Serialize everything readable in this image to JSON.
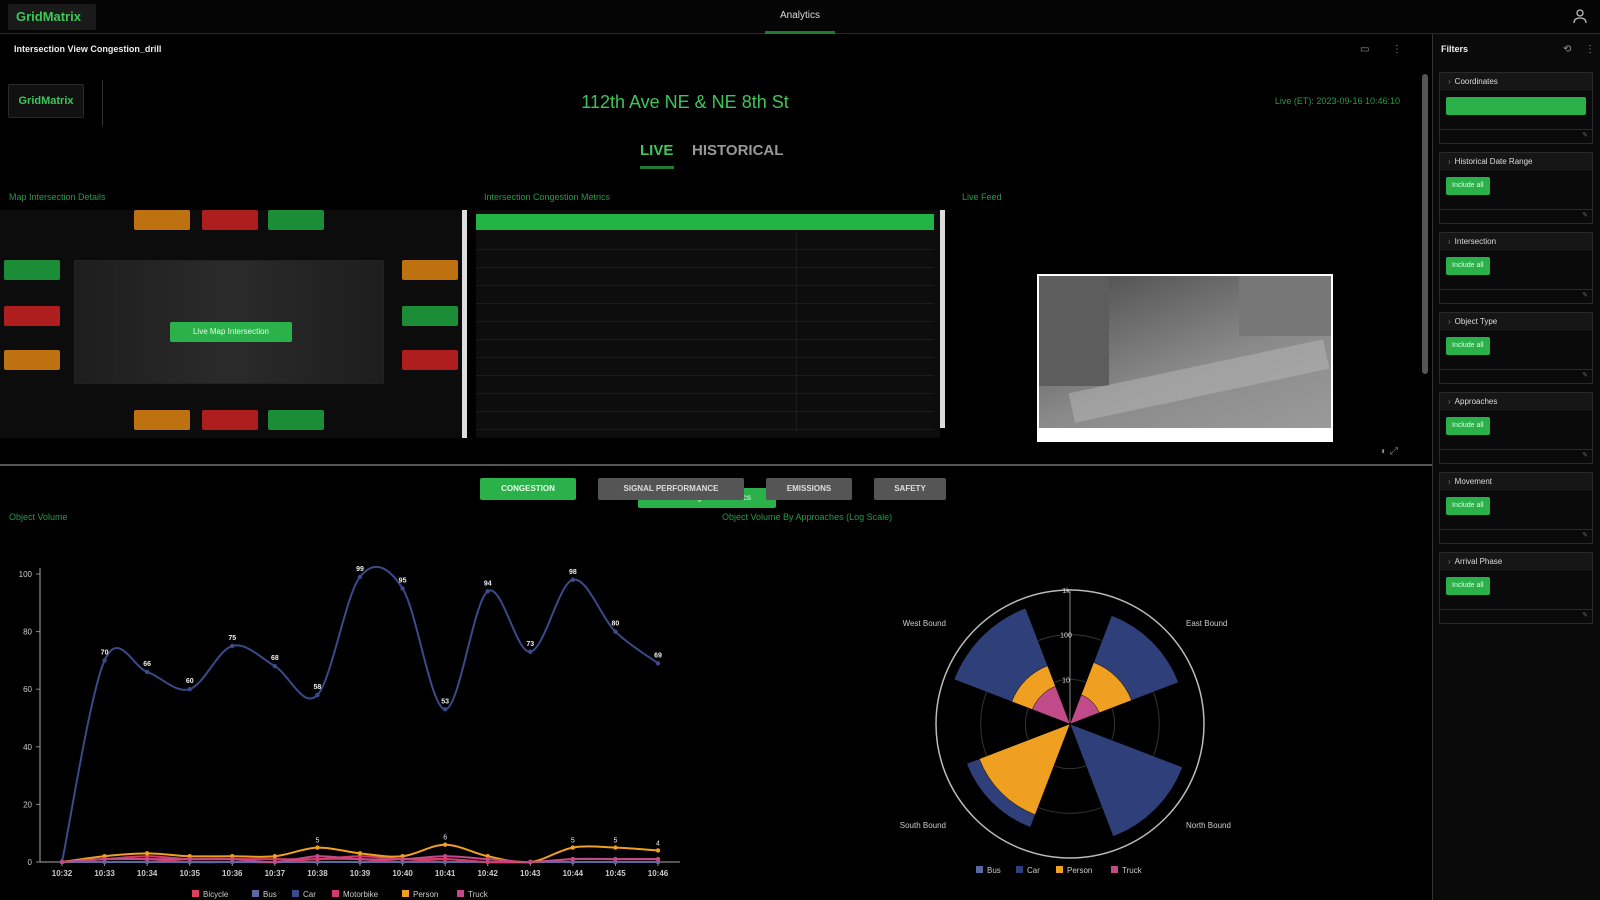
{
  "topbar": {
    "logo": "GridMatrix",
    "tab": "Analytics"
  },
  "panel": {
    "title": "Intersection View Congestion_drill",
    "brand": "GridMatrix",
    "location": "112th Ave NE & NE 8th St",
    "live_timestamp": "Live (ET): 2023-09-16 10:46:10",
    "tabs": {
      "live": "LIVE",
      "historical": "HISTORICAL"
    }
  },
  "map": {
    "label": "Map Intersection Details",
    "button": "Live Map Intersection",
    "signal_colors": {
      "orange": "#d07c10",
      "red": "#c02020",
      "green": "#1e9b3c"
    }
  },
  "congestion": {
    "label": "Intersection Congestion Metrics",
    "button": "View Congestion Metrics"
  },
  "feed": {
    "label": "Live Feed"
  },
  "analysis_tabs": [
    "CONGESTION",
    "SIGNAL PERFORMANCE",
    "EMISSIONS",
    "SAFETY"
  ],
  "filters": {
    "title": "Filters",
    "sections": [
      {
        "label": "Coordinates"
      },
      {
        "label": "Historical Date Range",
        "button": "Include all"
      },
      {
        "label": "Intersection",
        "button": "Include all"
      },
      {
        "label": "Object Type",
        "button": "Include all"
      },
      {
        "label": "Approaches",
        "button": "Include all"
      },
      {
        "label": "Movement",
        "button": "Include all"
      },
      {
        "label": "Arrival Phase",
        "button": "Include all"
      }
    ]
  },
  "chart_data": [
    {
      "type": "line",
      "title": "Object Volume",
      "x": [
        "10:32",
        "10:33",
        "10:34",
        "10:35",
        "10:36",
        "10:37",
        "10:38",
        "10:39",
        "10:40",
        "10:41",
        "10:42",
        "10:43",
        "10:44",
        "10:45",
        "10:46"
      ],
      "ylim": [
        0,
        100
      ],
      "yticks": [
        0,
        20,
        40,
        60,
        80,
        100
      ],
      "series": [
        {
          "name": "Bicycle",
          "color": "#e04060",
          "values": [
            0,
            1,
            1,
            0,
            0,
            0,
            1,
            1,
            0,
            1,
            0,
            0,
            0,
            0,
            0
          ]
        },
        {
          "name": "Bus",
          "color": "#5a6aa0",
          "values": [
            0,
            0,
            0,
            0,
            0,
            0,
            0,
            0,
            0,
            0,
            0,
            0,
            0,
            0,
            0
          ]
        },
        {
          "name": "Car",
          "color": "#3a4a8a",
          "values": [
            0,
            70,
            66,
            60,
            75,
            68,
            58,
            99,
            95,
            53,
            94,
            73,
            98,
            80,
            69
          ]
        },
        {
          "name": "Motorbike",
          "color": "#d63a6a",
          "values": [
            0,
            1,
            2,
            1,
            1,
            1,
            1,
            2,
            1,
            1,
            0,
            0,
            1,
            1,
            1
          ]
        },
        {
          "name": "Person",
          "color": "#f0a020",
          "values": [
            0,
            2,
            3,
            2,
            2,
            2,
            5,
            3,
            2,
            6,
            2,
            0,
            5,
            5,
            4
          ]
        },
        {
          "name": "Truck",
          "color": "#c04a8a",
          "values": [
            0,
            1,
            1,
            1,
            1,
            0,
            2,
            1,
            1,
            2,
            1,
            0,
            1,
            1,
            1
          ]
        }
      ],
      "labels": {
        "Car": [
          70,
          66,
          60,
          75,
          68,
          58,
          99,
          95,
          53,
          94,
          73,
          98,
          80,
          69
        ],
        "Person_peaks": [
          5,
          6,
          5,
          5,
          4
        ]
      }
    },
    {
      "type": "polar",
      "title": "Object Volume By Approaches (Log Scale)",
      "categories": [
        "East Bound",
        "North Bound",
        "South Bound",
        "West Bound"
      ],
      "radial_ticks": [
        "10",
        "100",
        "1k"
      ],
      "series": [
        {
          "name": "Bus",
          "color": "#5a6aa0",
          "values": [
            0,
            0,
            0,
            0
          ]
        },
        {
          "name": "Car",
          "color": "#2e3f7a",
          "values": [
            400,
            500,
            300,
            600
          ]
        },
        {
          "name": "Person",
          "color": "#f0a020",
          "values": [
            30,
            0,
            150,
            25
          ]
        },
        {
          "name": "Truck",
          "color": "#c04a8a",
          "values": [
            5,
            0,
            0,
            8
          ]
        }
      ]
    }
  ]
}
